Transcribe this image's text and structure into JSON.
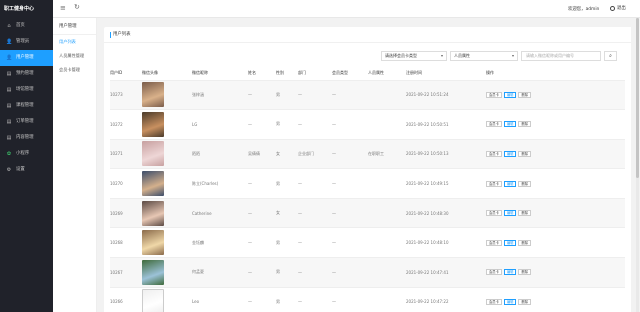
{
  "app": {
    "brand": "职工健身中心"
  },
  "sidebar": {
    "items": [
      {
        "icon": "home-icon",
        "glyph": "⌂",
        "label": "首页",
        "active": false
      },
      {
        "icon": "admin-icon",
        "glyph": "👤",
        "label": "管理员",
        "active": false
      },
      {
        "icon": "user-icon",
        "glyph": "👤",
        "label": "用户管理",
        "active": true
      },
      {
        "icon": "bookings-icon",
        "glyph": "▤",
        "label": "预约管理",
        "active": false
      },
      {
        "icon": "venue-icon",
        "glyph": "▤",
        "label": "场馆管理",
        "active": false
      },
      {
        "icon": "course-icon",
        "glyph": "▤",
        "label": "课程管理",
        "active": false
      },
      {
        "icon": "order-icon",
        "glyph": "▤",
        "label": "订单管理",
        "active": false
      },
      {
        "icon": "content-icon",
        "glyph": "▤",
        "label": "内容管理",
        "active": false
      },
      {
        "icon": "miniprogram-icon",
        "glyph": "✿",
        "label": "小程序",
        "active": false
      },
      {
        "icon": "settings-icon",
        "glyph": "⚙",
        "label": "设置",
        "active": false
      }
    ]
  },
  "topbar": {
    "welcome": "欢迎您，admin",
    "logout": "退出"
  },
  "submenu": {
    "title": "用户管理",
    "items": [
      {
        "label": "用户列表",
        "active": true
      },
      {
        "label": "人员属性管理",
        "active": false
      },
      {
        "label": "会员卡管理",
        "active": false
      }
    ]
  },
  "card": {
    "title": "用户列表"
  },
  "filters": {
    "card_type": "请选择会员卡类型",
    "attribute": "人员属性",
    "search_placeholder": "请输入微信昵称或用户编号",
    "search_icon": "search-icon"
  },
  "table": {
    "headers": [
      "用户ID",
      "微信头像",
      "微信昵称",
      "姓名",
      "性别",
      "部门",
      "会员类型",
      "人员属性",
      "注册时间",
      "操作"
    ],
    "ops": {
      "card": "会员卡",
      "edit": "编辑",
      "delete": "删除"
    },
    "rows": [
      {
        "id": "10273",
        "nick": "张梓涵",
        "name": "—",
        "gender": "男",
        "dept": "—",
        "type": "—",
        "attr": "",
        "time": "2021-09-22 10:51:24",
        "avatar": [
          "#7a5c4a",
          "#d9b18a"
        ]
      },
      {
        "id": "10272",
        "nick": "LG",
        "name": "—",
        "gender": "男",
        "dept": "—",
        "type": "—",
        "attr": "",
        "time": "2021-09-22 10:50:51",
        "avatar": [
          "#4a3a2a",
          "#c89060"
        ]
      },
      {
        "id": "10271",
        "nick": "陌陌",
        "name": "吴倩倩",
        "gender": "女",
        "dept": "企业部门",
        "type": "—",
        "attr": "在职职工",
        "time": "2021-09-22 10:50:13",
        "avatar": [
          "#c7a0a0",
          "#eed6d6"
        ]
      },
      {
        "id": "10270",
        "nick": "陈立(Charles)",
        "name": "—",
        "gender": "男",
        "dept": "—",
        "type": "—",
        "attr": "",
        "time": "2021-09-22 10:49:15",
        "avatar": [
          "#3c4d6a",
          "#d4b08c"
        ]
      },
      {
        "id": "10269",
        "nick": "Catherine",
        "name": "—",
        "gender": "女",
        "dept": "—",
        "type": "—",
        "attr": "",
        "time": "2021-09-22 10:48:30",
        "avatar": [
          "#5b4a44",
          "#e7c7b4"
        ]
      },
      {
        "id": "10268",
        "nick": "金钰麟",
        "name": "—",
        "gender": "男",
        "dept": "—",
        "type": "—",
        "attr": "",
        "time": "2021-09-22 10:48:10",
        "avatar": [
          "#8a6a4a",
          "#f0d8a8"
        ]
      },
      {
        "id": "10267",
        "nick": "何孟夏",
        "name": "—",
        "gender": "男",
        "dept": "—",
        "type": "—",
        "attr": "",
        "time": "2021-09-22 10:47:41",
        "avatar": [
          "#3e6a3a",
          "#9cc2d8"
        ]
      },
      {
        "id": "10266",
        "nick": "Leo",
        "name": "—",
        "gender": "男",
        "dept": "—",
        "type": "—",
        "attr": "",
        "time": "2021-09-22 10:47:22",
        "avatar": [
          "#efefef",
          "#ffffff"
        ]
      }
    ]
  }
}
